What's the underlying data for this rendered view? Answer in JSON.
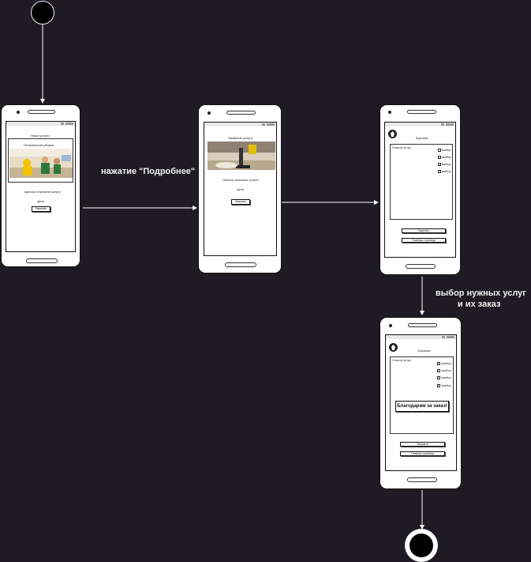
{
  "edges": {
    "e1_label": "нажатие \"Подробнее\"",
    "e3_label_line1": "выбор нужных услуг",
    "e3_label_line2": "и их заказ"
  },
  "screen1": {
    "header": "Наши услуги",
    "card_title": "Генеральная уборка",
    "description": "краткое описание услуги",
    "price": "цена",
    "order_button": "Заказать"
  },
  "screen2": {
    "header": "Название услуги",
    "description": "Полное описание услуги",
    "price": "цена",
    "order_button": "Заказать"
  },
  "screen3": {
    "header": "Корзина",
    "list_title": "Список услуг",
    "items": [
      "выбор",
      "выбор",
      "выбор",
      "выбор"
    ],
    "order_button": "Заказать",
    "home_button": "Главная страница"
  },
  "screen4": {
    "header": "Корзина",
    "list_title": "Список услуг",
    "items": [
      "выбор",
      "выбор",
      "выбор",
      "выбор"
    ],
    "thanks": "Благодарим за заказ!",
    "order_button": "Заказать",
    "home_button": "Главная страница"
  },
  "colors": {
    "background": "#1e1b24",
    "arrow": "#ffffff",
    "phone": "#ffffff"
  }
}
